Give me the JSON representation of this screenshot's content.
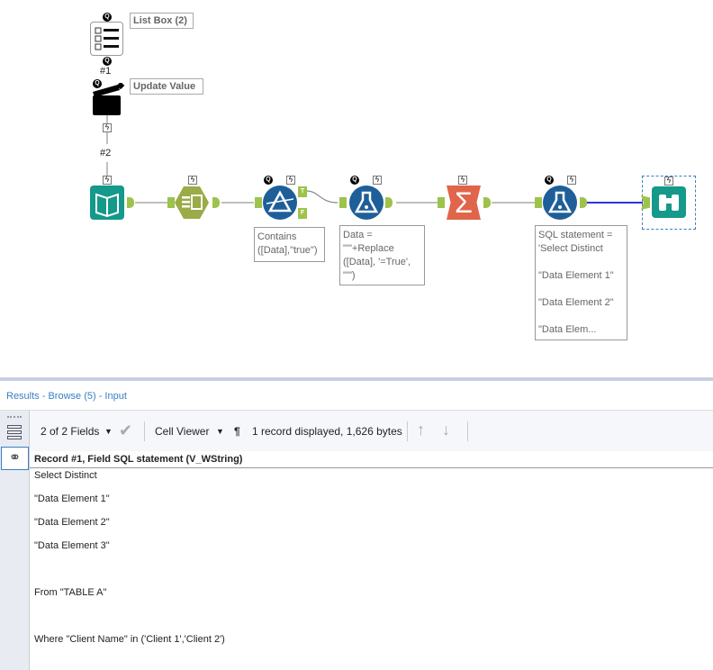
{
  "workflow": {
    "tools": [
      {
        "name": "List Box (2)",
        "type": "list-box"
      },
      {
        "name": "Update Value",
        "type": "action"
      },
      {
        "type": "input-data"
      },
      {
        "type": "select"
      },
      {
        "type": "filter",
        "outputs": [
          "T",
          "F"
        ]
      },
      {
        "type": "formula"
      },
      {
        "type": "summarize"
      },
      {
        "type": "formula"
      },
      {
        "type": "browse"
      }
    ],
    "connection_labels": [
      "#1",
      "#2"
    ],
    "annotations": {
      "filter": "Contains\n([Data],\"true\")",
      "formula1": "Data =\n\"'\"+Replace\n([Data], '=True',\n\"'\")",
      "formula2": "SQL statement =\n'Select Distinct\n\n\"Data Element 1\"\n\n\"Data Element 2\"\n\n\"Data Elem..."
    },
    "filter_true": "T",
    "filter_false": "F"
  },
  "results": {
    "title": "Results - Browse (5) - Input",
    "fields_selector": "2 of 2 Fields",
    "viewer": "Cell Viewer",
    "pilcrow": "¶",
    "status": "1 record displayed, 1,626 bytes",
    "record_header": "Record #1, Field SQL statement (V_WString)",
    "cell_text": "Select Distinct\n\n\"Data Element 1\"\n\n\"Data Element 2\"\n\n\"Data Element 3\"\n\n\n\nFrom \"TABLE A\"\n\n\n\nWhere \"Client Name\" in ('Client 1','Client 2')"
  },
  "colors": {
    "teal": "#14998a",
    "olive": "#9aab47",
    "blue": "#1f5f99",
    "orange": "#e0654a",
    "link": "#3a7fc4",
    "anchor": "#9dc34a"
  }
}
